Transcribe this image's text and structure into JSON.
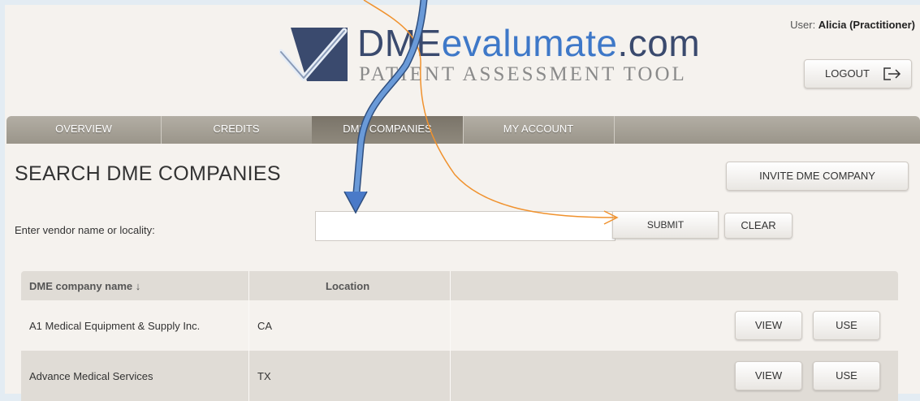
{
  "header": {
    "logo_main": "DME",
    "logo_accent": "evalumate",
    "logo_domain": ".com",
    "logo_subtitle": "PATIENT ASSESSMENT TOOL",
    "user_prefix": "User: ",
    "user_name": "Alicia (Practitioner)",
    "logout_label": "LOGOUT"
  },
  "nav": {
    "tabs": [
      {
        "label": "OVERVIEW"
      },
      {
        "label": "CREDITS"
      },
      {
        "label": "DME COMPANIES"
      },
      {
        "label": "MY ACCOUNT"
      }
    ],
    "active": "DME COMPANIES"
  },
  "main": {
    "title": "SEARCH DME COMPANIES",
    "invite_label": "INVITE DME COMPANY",
    "search_label": "Enter vendor name or locality:",
    "search_value": "",
    "submit_label": "SUBMIT",
    "clear_label": "CLEAR"
  },
  "table": {
    "columns": [
      "DME company name ↓",
      "Location",
      ""
    ],
    "rows": [
      {
        "name": "A1 Medical Equipment & Supply Inc.",
        "location": "CA",
        "view": "VIEW",
        "use": "USE"
      },
      {
        "name": "Advance Medical Services",
        "location": "TX",
        "view": "VIEW",
        "use": "USE"
      }
    ]
  },
  "colors": {
    "brand_dark": "#3a4a6e",
    "brand_accent": "#3e78c8",
    "nav_bg": "#a39e93",
    "annotation_blue": "#4a7ac8",
    "annotation_orange": "#f0922e"
  },
  "icons": [
    "logo-checkmark-icon",
    "logout-arrow-icon",
    "sort-down-arrow-icon"
  ]
}
